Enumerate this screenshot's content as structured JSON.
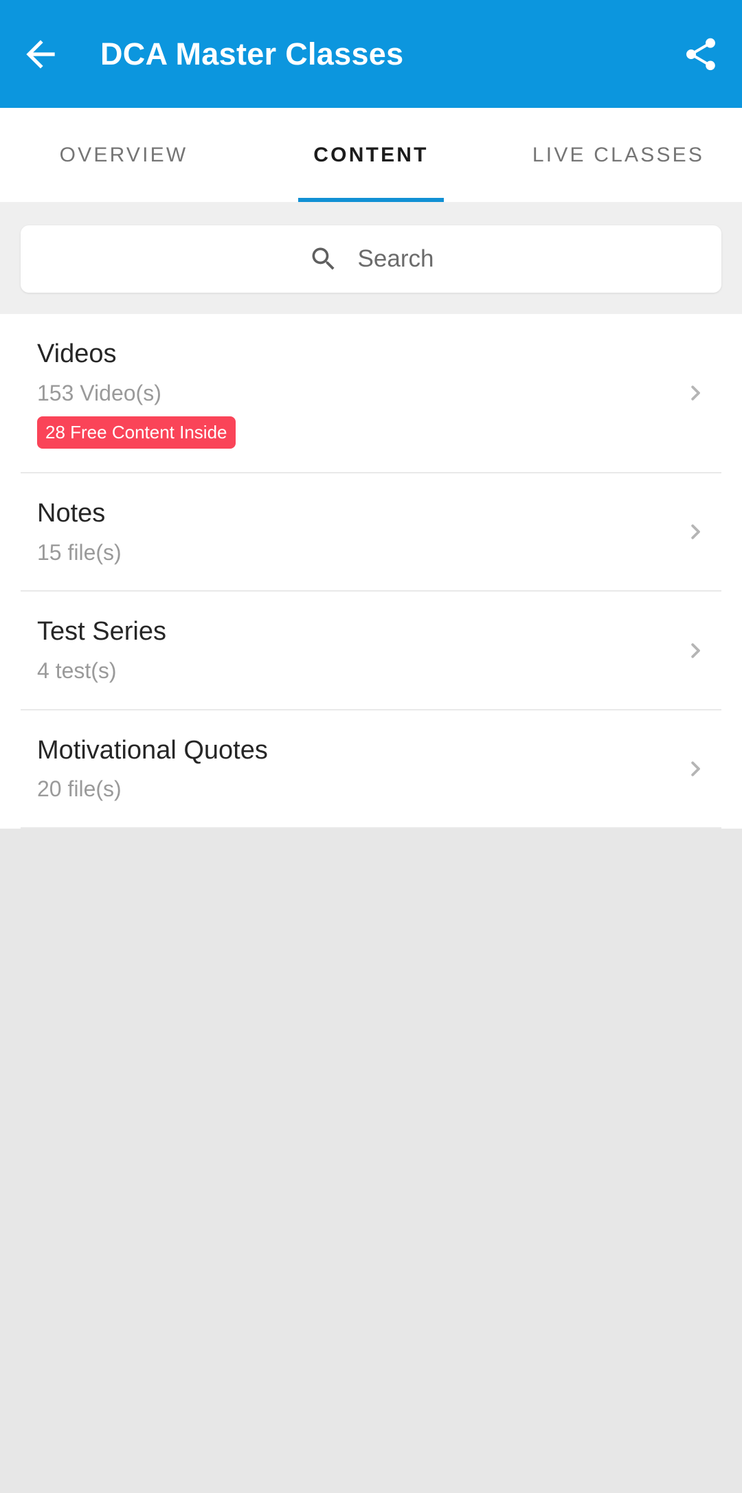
{
  "appbar": {
    "back_icon": "arrow-left-icon",
    "title": "DCA Master Classes",
    "share_icon": "share-icon",
    "background_color": "#0c96de",
    "title_color": "#ffffff"
  },
  "tabs": [
    {
      "label": "OVERVIEW",
      "active": false
    },
    {
      "label": "CONTENT",
      "active": true
    },
    {
      "label": "LIVE CLASSES",
      "active": false
    }
  ],
  "tabs_meta": {
    "active_color": "#1c1c1c",
    "inactive_color": "#757575",
    "indicator_color": "#1190d4"
  },
  "search": {
    "icon": "search-icon",
    "placeholder": "Search",
    "value": ""
  },
  "list": {
    "items": [
      {
        "title": "Videos",
        "subtitle": "153 Video(s)",
        "badge": "28 Free Content Inside",
        "badge_color": "#fa4458",
        "chevron": "chevron-right-icon"
      },
      {
        "title": "Notes",
        "subtitle": "15 file(s)",
        "badge": null,
        "chevron": "chevron-right-icon"
      },
      {
        "title": "Test Series",
        "subtitle": "4 test(s)",
        "badge": null,
        "chevron": "chevron-right-icon"
      },
      {
        "title": "Motivational Quotes",
        "subtitle": "20 file(s)",
        "badge": null,
        "chevron": "chevron-right-icon"
      }
    ]
  },
  "background": {
    "page_color": "#e7e7e7",
    "card_color": "#ffffff",
    "strip_color": "#efefef"
  }
}
